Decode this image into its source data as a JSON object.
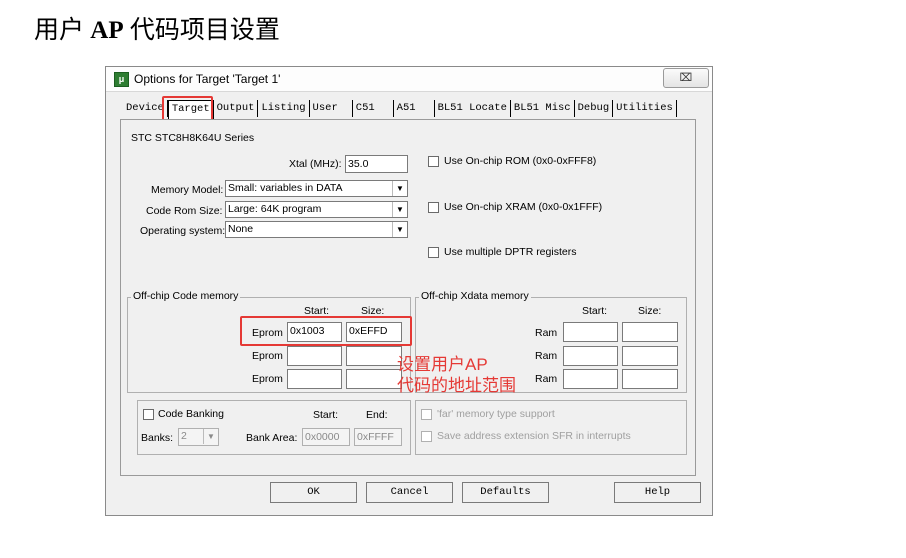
{
  "heading": {
    "prefix": "用户 ",
    "bold": "AP",
    "suffix": " 代码项目设置"
  },
  "dialog": {
    "title": "Options for Target 'Target 1'",
    "close": "⌧",
    "tabs": [
      "Device",
      "Target",
      "Output",
      "Listing",
      "User",
      "C51",
      "A51",
      "BL51 Locate",
      "BL51 Misc",
      "Debug",
      "Utilities"
    ],
    "active_tab": "Target",
    "device_name": "STC STC8H8K64U Series",
    "xtal_label": "Xtal (MHz):",
    "xtal_value": "35.0",
    "memory_model_label": "Memory Model:",
    "memory_model_value": "Small: variables in DATA",
    "code_rom_label": "Code Rom Size:",
    "code_rom_value": "Large: 64K program",
    "os_label": "Operating system:",
    "os_value": "None",
    "onchip_rom": "Use On-chip ROM (0x0-0xFFF8)",
    "onchip_xram": "Use On-chip XRAM (0x0-0x1FFF)",
    "multi_dptr": "Use multiple DPTR registers",
    "offchip_code": {
      "title": "Off-chip Code memory",
      "start_hdr": "Start:",
      "size_hdr": "Size:",
      "rows": [
        {
          "label": "Eprom",
          "start": "0x1003",
          "size": "0xEFFD"
        },
        {
          "label": "Eprom",
          "start": "",
          "size": ""
        },
        {
          "label": "Eprom",
          "start": "",
          "size": ""
        }
      ]
    },
    "offchip_xdata": {
      "title": "Off-chip Xdata memory",
      "start_hdr": "Start:",
      "size_hdr": "Size:",
      "rows": [
        {
          "label": "Ram",
          "start": "",
          "size": ""
        },
        {
          "label": "Ram",
          "start": "",
          "size": ""
        },
        {
          "label": "Ram",
          "start": "",
          "size": ""
        }
      ]
    },
    "code_banking": {
      "label": "Code Banking",
      "start_hdr": "Start:",
      "end_hdr": "End:",
      "banks_label": "Banks:",
      "banks_value": "2",
      "bank_area_label": "Bank Area:",
      "bank_start": "0x0000",
      "bank_end": "0xFFFF"
    },
    "far_support": "'far' memory type support",
    "save_sfr": "Save address extension SFR in interrupts",
    "buttons": {
      "ok": "OK",
      "cancel": "Cancel",
      "defaults": "Defaults",
      "help": "Help"
    }
  },
  "annotation": {
    "line1": "设置用户AP",
    "line2": "代码的地址范围"
  },
  "colors": {
    "annotation": "#e53935",
    "dialog_bg": "#f0f0f0"
  }
}
